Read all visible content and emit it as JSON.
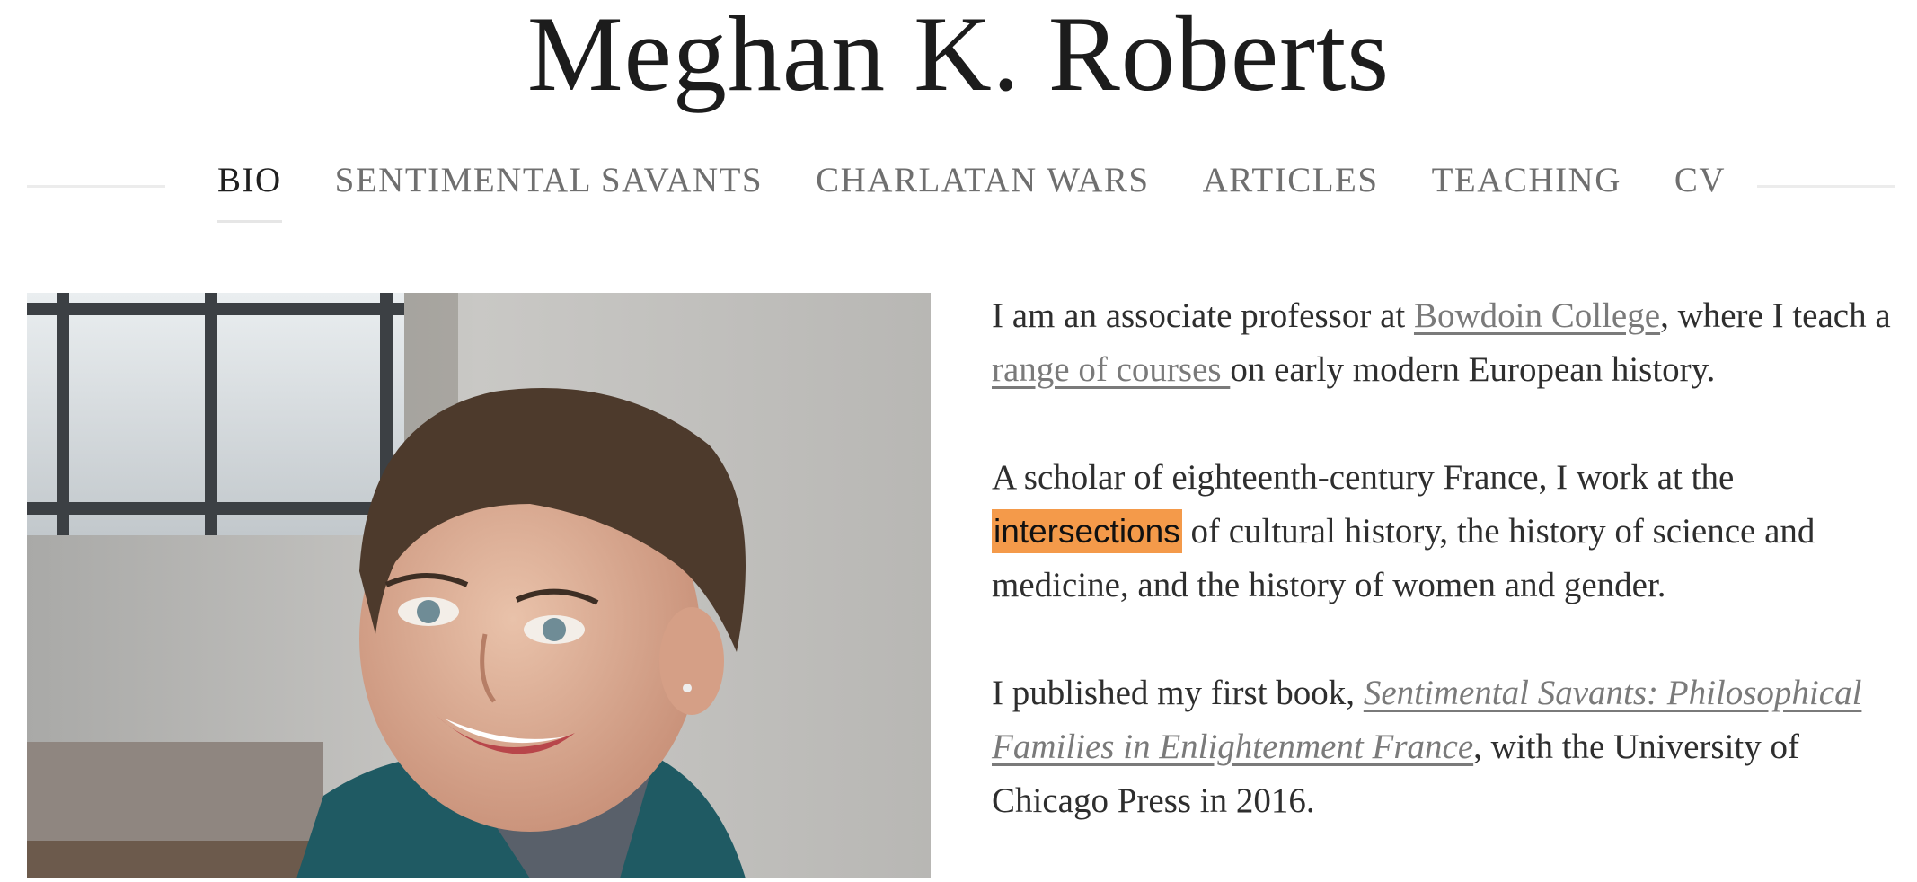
{
  "site": {
    "title": "Meghan K. Roberts"
  },
  "nav": {
    "items": [
      {
        "label": "BIO",
        "active": true
      },
      {
        "label": "SENTIMENTAL SAVANTS",
        "active": false
      },
      {
        "label": "CHARLATAN WARS",
        "active": false
      },
      {
        "label": "ARTICLES",
        "active": false
      },
      {
        "label": "TEACHING",
        "active": false
      },
      {
        "label": "CV",
        "active": false
      }
    ]
  },
  "bio": {
    "p1": {
      "t1": "I am an associate professor at ",
      "link1": "Bowdoin College",
      "t2": ", where I teach a ",
      "link2": "range of courses ",
      "t3": "on early modern European history."
    },
    "p2": {
      "t1": "A scholar of eighteenth-century France, I work at the ",
      "highlight": "intersections",
      "t2": " of cultural history, the history of science and medicine, and the history of women and gender."
    },
    "p3": {
      "t1": "I published my first book, ",
      "link": "Sentimental Savants: Philosophical Families in Enlightenment France",
      "t2": ", with the University of Chicago Press in 2016."
    }
  },
  "colors": {
    "highlight": "#f49a4a",
    "link": "#7a7a7a",
    "text": "#2e2e2e",
    "title": "#1c1c1c"
  }
}
